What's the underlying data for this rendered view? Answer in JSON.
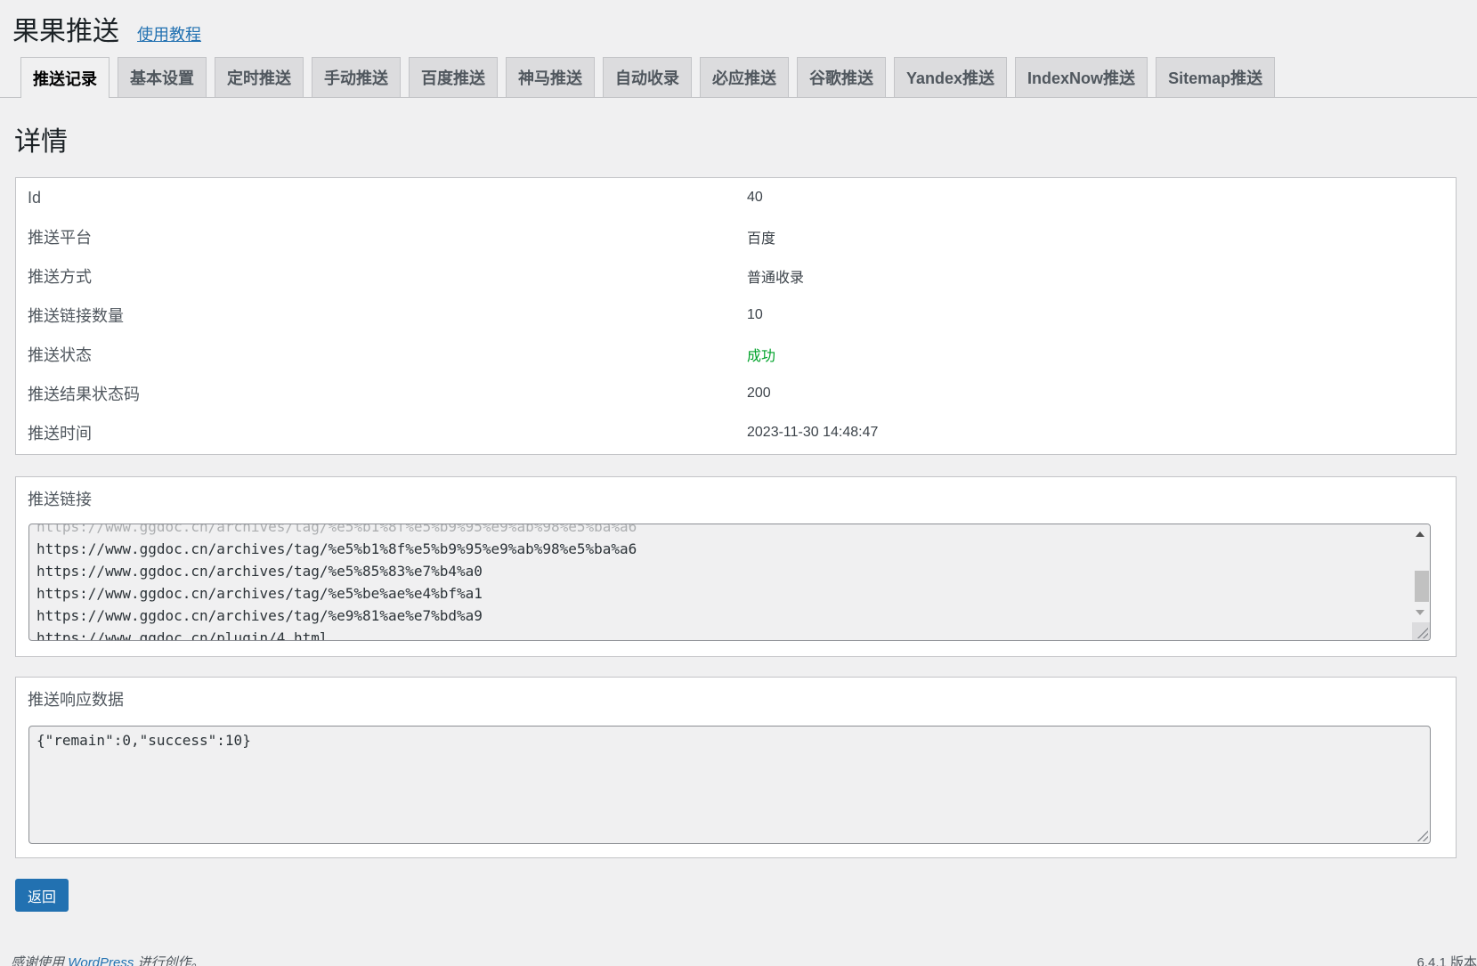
{
  "header": {
    "title": "果果推送",
    "tutorial_link": "使用教程"
  },
  "tabs": [
    {
      "label": "推送记录",
      "active": true
    },
    {
      "label": "基本设置"
    },
    {
      "label": "定时推送"
    },
    {
      "label": "手动推送"
    },
    {
      "label": "百度推送"
    },
    {
      "label": "神马推送"
    },
    {
      "label": "自动收录"
    },
    {
      "label": "必应推送"
    },
    {
      "label": "谷歌推送"
    },
    {
      "label": "Yandex推送"
    },
    {
      "label": "IndexNow推送"
    },
    {
      "label": "Sitemap推送"
    }
  ],
  "section_title": "详情",
  "details": [
    {
      "label": "Id",
      "value": "40"
    },
    {
      "label": "推送平台",
      "value": "百度"
    },
    {
      "label": "推送方式",
      "value": "普通收录"
    },
    {
      "label": "推送链接数量",
      "value": "10"
    },
    {
      "label": "推送状态",
      "value": "成功"
    },
    {
      "label": "推送结果状态码",
      "value": "200"
    },
    {
      "label": "推送时间",
      "value": "2023-11-30 14:48:47"
    }
  ],
  "links_section": {
    "label": "推送链接",
    "lines": [
      "https://www.ggdoc.cn/archives/tag/%e5%b1%8f%e5%b9%95%e9%ab%98%e5%ba%a6",
      "https://www.ggdoc.cn/archives/tag/%e5%85%83%e7%b4%a0",
      "https://www.ggdoc.cn/archives/tag/%e5%be%ae%e4%bf%a1",
      "https://www.ggdoc.cn/archives/tag/%e9%81%ae%e7%bd%a9",
      "https://www.ggdoc.cn/plugin/4.html"
    ]
  },
  "response_section": {
    "label": "推送响应数据",
    "content": "{\"remain\":0,\"success\":10}"
  },
  "back_button": "返回",
  "footer": {
    "thanks_prefix": "感谢使用",
    "wordpress_link": "WordPress",
    "thanks_suffix": "进行创作。",
    "version": "6.4.1 版本"
  },
  "colors": {
    "accent": "#2271b1",
    "success": "#00a32a",
    "background": "#f0f0f1"
  }
}
